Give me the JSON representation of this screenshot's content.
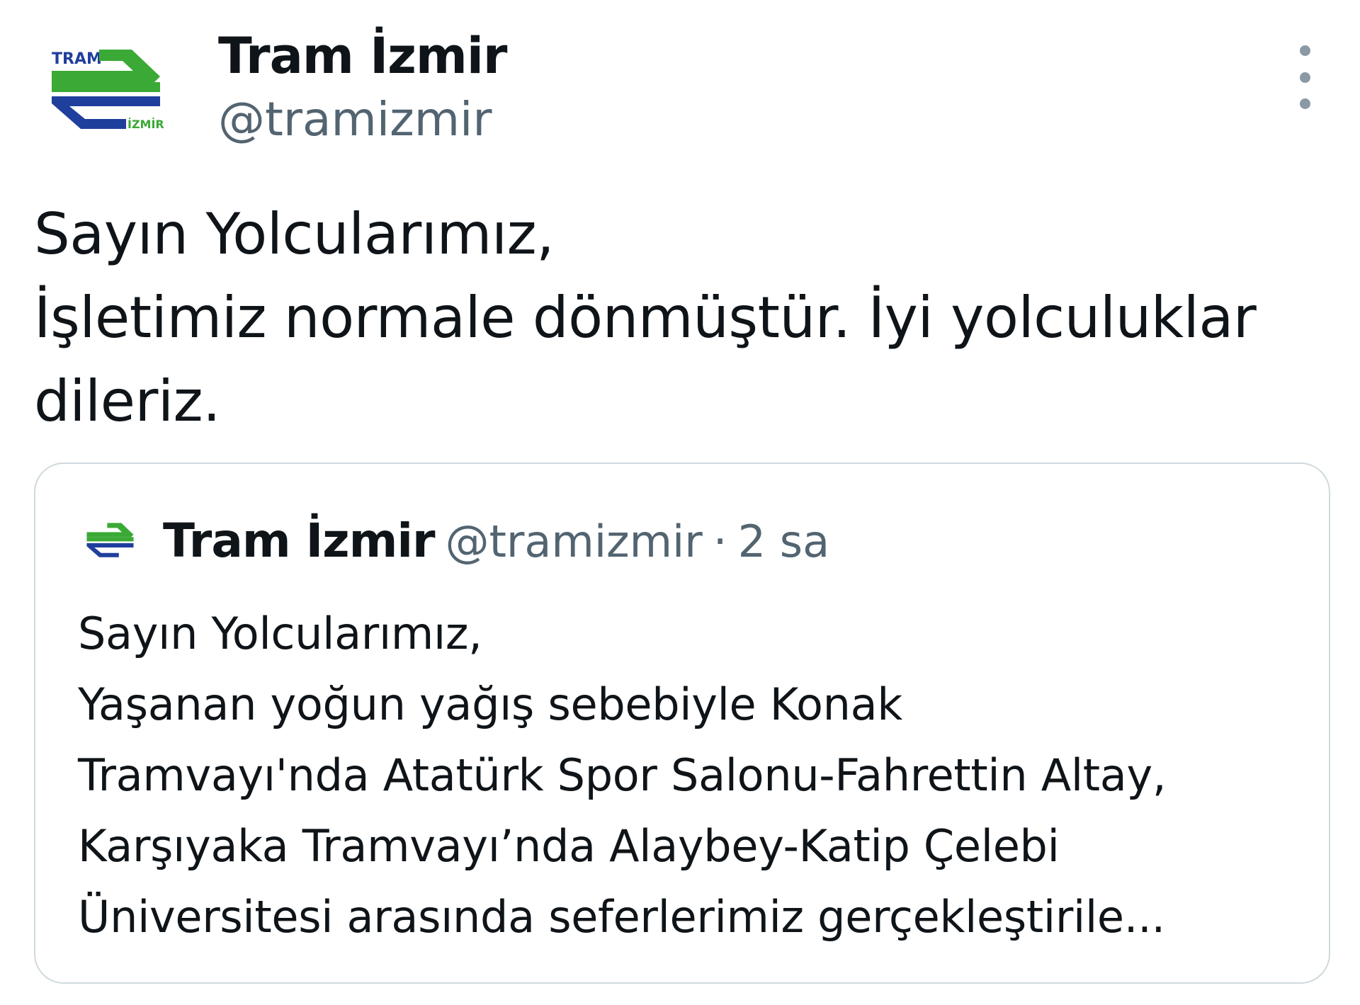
{
  "tweet": {
    "author": {
      "name": "Tram İzmir",
      "handle": "@tramizmir",
      "avatar": {
        "icon": "tram-izmir-logo",
        "logo_text_top": "TRAM",
        "logo_text_bottom": "İZMİR"
      }
    },
    "menu_icon": "more-options-icon",
    "text_lines": [
      "Sayın Yolcularımız,",
      "İşletimiz normale dönmüştür. İyi yolculuklar",
      "dileriz."
    ],
    "quoted": {
      "author_name": "Tram İzmir",
      "handle": "@tramizmir",
      "separator": "·",
      "time": "2 sa",
      "text_lines": [
        "Sayın Yolcularımız,",
        "Yaşanan yoğun yağış sebebiyle Konak",
        "Tramvayı'nda Atatürk Spor Salonu-Fahrettin Altay,",
        "Karşıyaka Tramvayı’nda Alaybey-Katip Çelebi",
        "Üniversitesi arasında seferlerimiz gerçekleştirile..."
      ]
    }
  },
  "colors": {
    "text": "#0f1419",
    "secondary": "#536471",
    "border": "#cfd9de",
    "logo_green": "#3aa935",
    "logo_blue": "#1f3f9c"
  }
}
